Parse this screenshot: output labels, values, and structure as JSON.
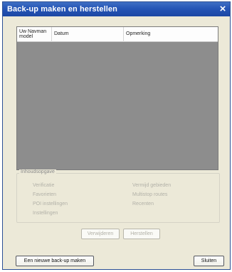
{
  "window": {
    "title": "Back-up maken en herstellen",
    "close_icon": "×"
  },
  "backup_list": {
    "columns": [
      {
        "label": "Uw Navman model"
      },
      {
        "label": "Datum"
      },
      {
        "label": "Opmerking"
      }
    ],
    "rows": []
  },
  "contents": {
    "label": "Inhoudsopgave",
    "left_items": [
      "Verificatie",
      "Favorieten",
      "POI instellingen",
      "Instellingen"
    ],
    "right_items": [
      "Vermijd gebieden",
      "Multistop routes",
      "Recenten"
    ]
  },
  "actions": {
    "delete_label": "Verwijderen",
    "restore_label": "Herstellen"
  },
  "footer": {
    "new_backup_label": "Een nieuwe back-up maken",
    "close_label": "Sluiten"
  },
  "colors": {
    "title_bar": "#2555b6",
    "list_background": "#8d8d8d",
    "window_background": "#ece9d8",
    "disabled_text": "#b2b1a8"
  }
}
